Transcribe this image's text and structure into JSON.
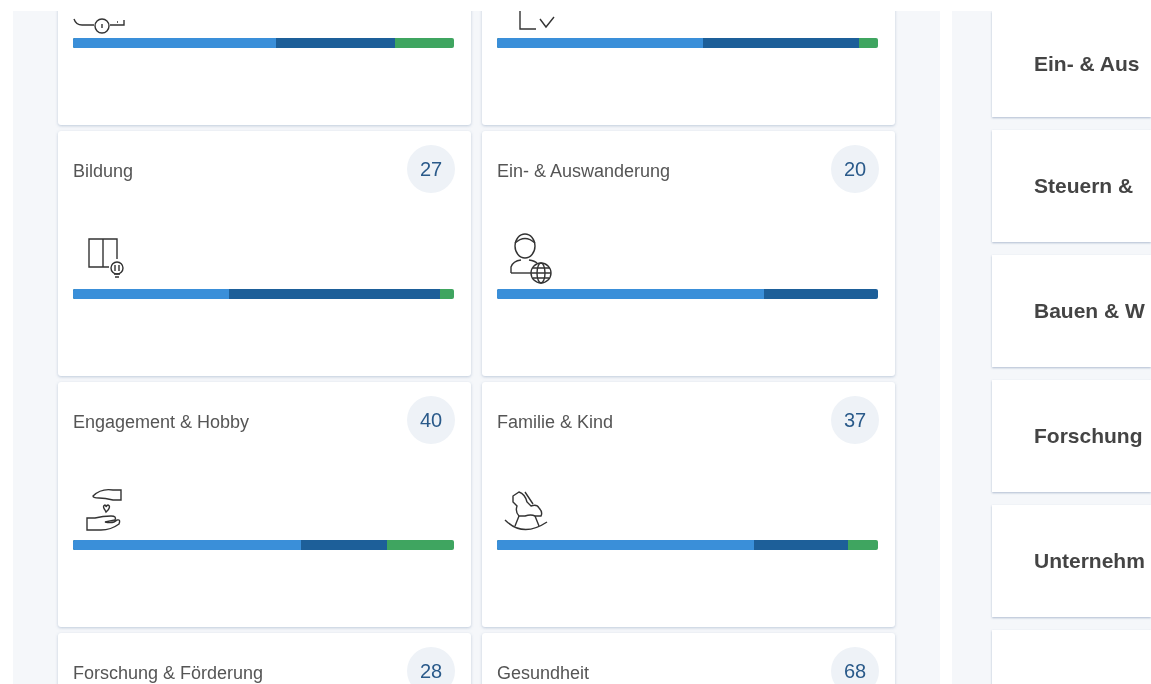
{
  "categories": [
    {
      "bar": {
        "color": "#3fa560",
        "segments": [
          {
            "level": 0.844,
            "color": "#1d5f99"
          },
          {
            "level": 0.533,
            "color": "#3a8fd9"
          }
        ]
      }
    },
    {
      "bar": {
        "color": "#3fa560",
        "segments": [
          {
            "level": 0.95,
            "color": "#1d5f99"
          },
          {
            "level": 0.54,
            "color": "#3a8fd9"
          }
        ]
      }
    },
    {
      "title": "Bildung",
      "count": "27",
      "bar": {
        "color": "#3fa560",
        "segments": [
          {
            "level": 0.964,
            "color": "#1d5f99"
          },
          {
            "level": 0.41,
            "color": "#3a8fd9"
          }
        ]
      }
    },
    {
      "title": "Ein- & Auswanderung",
      "count": "20",
      "bar": {
        "color": "#1d5f99",
        "segments": [
          {
            "level": 0.7,
            "color": "#3a8fd9"
          }
        ]
      }
    },
    {
      "title": "Engagement & Hobby",
      "count": "40",
      "bar": {
        "color": "#3fa560",
        "segments": [
          {
            "level": 0.824,
            "color": "#1d5f99"
          },
          {
            "level": 0.598,
            "color": "#3a8fd9"
          }
        ]
      }
    },
    {
      "title": "Familie & Kind",
      "count": "37",
      "bar": {
        "color": "#3fa560",
        "segments": [
          {
            "level": 0.922,
            "color": "#1d5f99"
          },
          {
            "level": 0.675,
            "color": "#3a8fd9"
          }
        ]
      }
    },
    {
      "title": "Forschung & Förderung",
      "count": "28"
    },
    {
      "title": "Gesundheit",
      "count": "68"
    }
  ],
  "side_topics": [
    "Ein- & Aus",
    "Steuern &",
    "Bauen & W",
    "Forschung",
    "Unternehm"
  ]
}
